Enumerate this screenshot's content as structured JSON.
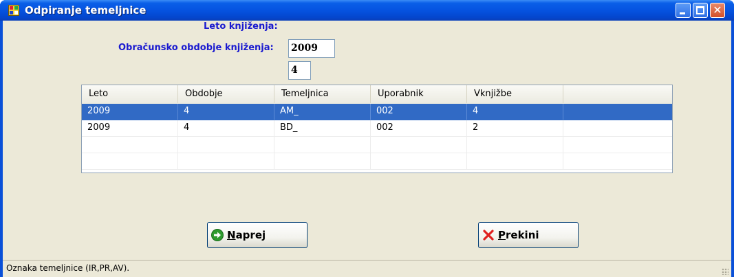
{
  "window": {
    "title": "Odpiranje temeljnice"
  },
  "form": {
    "year_label": "Leto knjiženja:",
    "year_value": "2009",
    "period_label": "Obračunsko obdobje knjiženja:",
    "period_value": "4"
  },
  "grid": {
    "columns": [
      "Leto",
      "Obdobje",
      "Temeljnica",
      "Uporabnik",
      "Vknjižbe",
      ""
    ],
    "rows": [
      [
        "2009",
        "4",
        "AM_",
        "002",
        "4",
        ""
      ],
      [
        "2009",
        "4",
        "BD_",
        "002",
        "2",
        ""
      ],
      [
        "",
        "",
        "",
        "",
        "",
        ""
      ],
      [
        "",
        "",
        "",
        "",
        "",
        ""
      ]
    ],
    "selected_row": 0
  },
  "buttons": {
    "next_mnemonic": "N",
    "next_rest": "aprej",
    "next_icon": "arrow-right-icon",
    "cancel_mnemonic": "P",
    "cancel_rest": "rekini",
    "cancel_icon": "red-x-icon"
  },
  "status": {
    "text": "Oznaka temeljnice (IR,PR,AV)."
  },
  "colors": {
    "label_blue": "#1a1ad0",
    "selection": "#316ac5",
    "titlebar": "#0553e0"
  }
}
